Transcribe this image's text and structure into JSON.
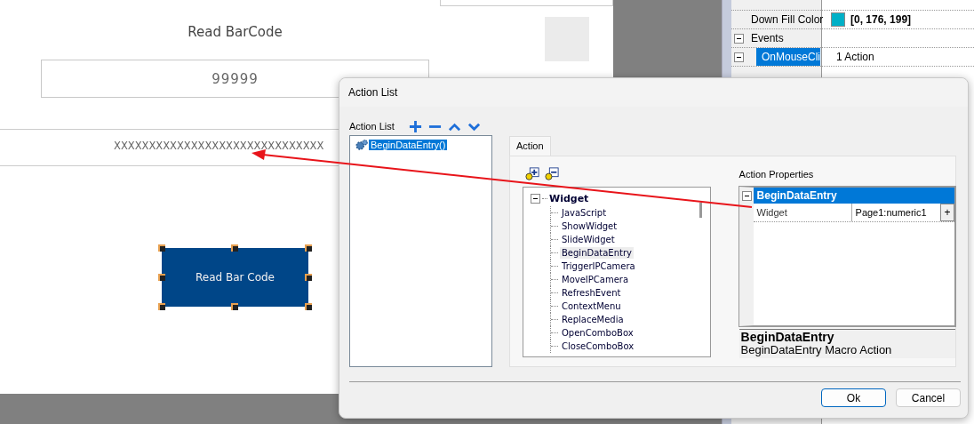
{
  "canvas": {
    "title": "Read BarCode",
    "numeric_value": "99999",
    "text_value": "XXXXXXXXXXXXXXXXXXXXXXXXXXXXXX",
    "button": {
      "label": "Read Bar Code",
      "selected": true
    }
  },
  "properties": [
    {
      "kind": "color",
      "name": "Down Fill Color",
      "value": "[0, 176, 199]",
      "color": "#00b0c7"
    },
    {
      "kind": "category",
      "name": "Events",
      "expanded": true
    },
    {
      "kind": "event",
      "name": "OnMouseCli",
      "value": "1 Action",
      "expanded": true,
      "selected": true
    }
  ],
  "dialog": {
    "title": "Action List",
    "list_label": "Action List",
    "actions": [
      {
        "label": "BeginDataEntry()",
        "selected": true
      }
    ],
    "tabs": [
      {
        "label": "Action",
        "selected": true
      }
    ],
    "tree": {
      "label": "Widget",
      "expanded": true,
      "children": [
        {
          "label": "JavaScript",
          "selected": false
        },
        {
          "label": "ShowWidget",
          "selected": false
        },
        {
          "label": "SlideWidget",
          "selected": false
        },
        {
          "label": "BeginDataEntry",
          "selected": true
        },
        {
          "label": "TriggerIPCamera",
          "selected": false
        },
        {
          "label": "MoveIPCamera",
          "selected": false
        },
        {
          "label": "RefreshEvent",
          "selected": false
        },
        {
          "label": "ContextMenu",
          "selected": false
        },
        {
          "label": "ReplaceMedia",
          "selected": false
        },
        {
          "label": "OpenComboBox",
          "selected": false
        },
        {
          "label": "CloseComboBox",
          "selected": false
        }
      ]
    },
    "properties_label": "Action Properties",
    "grid": {
      "category": "BeginDataEntry",
      "expanded": true,
      "rows": [
        {
          "name": "Widget",
          "value": "Page1:numeric1",
          "button": "+"
        }
      ]
    },
    "description": {
      "title": "BeginDataEntry",
      "text": "BeginDataEntry Macro Action"
    },
    "buttons": [
      {
        "label": "Ok",
        "default": true
      },
      {
        "label": "Cancel",
        "default": false
      }
    ]
  }
}
